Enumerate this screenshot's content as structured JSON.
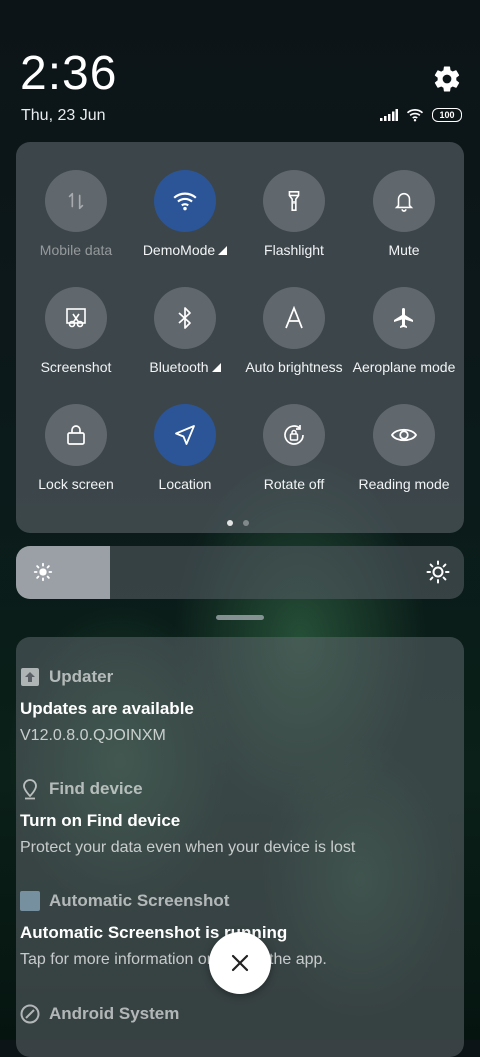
{
  "status_bar": {
    "time": "2:36",
    "date": "Thu, 23 Jun",
    "battery_level": "100"
  },
  "quick_settings": {
    "tiles": [
      {
        "label": "Mobile data",
        "icon": "mobile-data-icon",
        "active": false,
        "disabled": true
      },
      {
        "label": "DemoMode",
        "icon": "wifi-icon",
        "active": true,
        "expandable": true
      },
      {
        "label": "Flashlight",
        "icon": "flashlight-icon",
        "active": false
      },
      {
        "label": "Mute",
        "icon": "bell-icon",
        "active": false
      },
      {
        "label": "Screenshot",
        "icon": "scissors-icon",
        "active": false
      },
      {
        "label": "Bluetooth",
        "icon": "bluetooth-icon",
        "active": false,
        "expandable": true
      },
      {
        "label": "Auto brightness",
        "icon": "auto-brightness-icon",
        "active": false
      },
      {
        "label": "Aeroplane mode",
        "icon": "airplane-icon",
        "active": false
      },
      {
        "label": "Lock screen",
        "icon": "lock-icon",
        "active": false
      },
      {
        "label": "Location",
        "icon": "location-arrow-icon",
        "active": true
      },
      {
        "label": "Rotate off",
        "icon": "rotate-lock-icon",
        "active": false
      },
      {
        "label": "Reading mode",
        "icon": "eye-icon",
        "active": false
      }
    ],
    "page_count": 2,
    "current_page": 1
  },
  "brightness": {
    "level": 0.21
  },
  "notifications": [
    {
      "app": "Updater",
      "icon": "updater-icon",
      "title": "Updates are available",
      "text": "V12.0.8.0.QJOINXM"
    },
    {
      "app": "Find device",
      "icon": "location-pin-icon",
      "title": "Turn on Find device",
      "text": "Protect your data even when your device is lost"
    },
    {
      "app": "Automatic Screenshot",
      "icon": "screenshot-app-icon",
      "title": "Automatic Screenshot is running",
      "text": "Tap for more information or to stop the app."
    },
    {
      "app": "Android System",
      "icon": "android-system-icon",
      "title": "",
      "text": ""
    }
  ],
  "colors": {
    "active_tile": "#2b5597",
    "tile": "#7d848a"
  }
}
